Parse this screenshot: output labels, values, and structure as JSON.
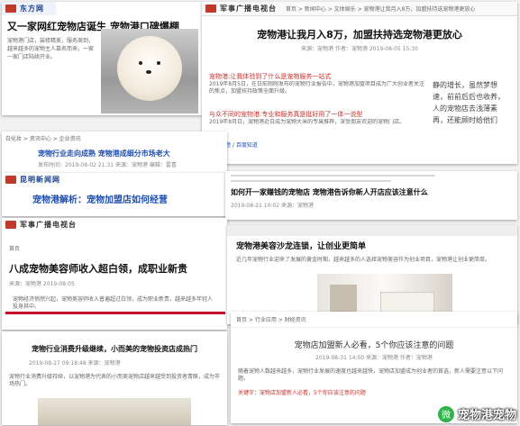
{
  "cards": {
    "c1": {
      "logo": "东方网",
      "headline": "又一家网红宠物店诞生 宠物港口碑爆棚",
      "body": "宠物港门店，装修精美，服务周到，越来越多的宠物主人慕名而来，一家一家门店陆续开业。"
    },
    "c2": {
      "breadcrumb": "首页 > 新闻中心 > 文体娱乐 > 宠物港让我月入8万，加盟扶持选宠物港更放心",
      "logo": "军事广播电视台",
      "headline": "宠物港让我月入8万，加盟扶持选宠物港更放心",
      "meta": "来源：宠物港 作者：宠物港 2019-08-05 15:30",
      "link1": "宠物港:让我体验到了什么是宠物服务一站式",
      "body1": "2019年8月5日，在日前刚刚发布的宠物行业报告中，宠物港加盟项目成为广大创业者关注的焦点，加盟扶持政策全面升级。",
      "link2": "与众不同的宠物港:专业和服务真是挺好用了一体一说型",
      "body2": "2019年8月日，宠物港近日成为宠物大米的专属推荐，深受朋友欢迎的宠物门店。",
      "aside": "静的增长，虽然梦想速，前前后后也收养，人的宠物店去浅薄素再，还能顾时给他们",
      "tag": "热点话题 / 百度知道"
    },
    "c3": {
      "breadcrumb": "白化妆 > 资讯中心 > 企业资讯",
      "headline": "宠物行业走向成熟 宠物港成细分市场老大",
      "meta": "发布时间：2019-08-02 21:31 来源：宠物港 编辑：雷喜"
    },
    "c4": {
      "logo": "昆明新闻网",
      "headline": "宠物港解析：宠物加盟店如何经营"
    },
    "c5": {
      "headline": "如何开一家赚钱的宠物店 宠物港告诉你新人开店应该注意什么",
      "meta": "2019-08-21 10:02 来源：宠物港"
    },
    "c6": {
      "logo": "军事广播电视台",
      "crumb": "首页",
      "headline": "八成宠物美容师收入超白领，成职业新贵",
      "meta": "来源：宠物港 2019-08-05",
      "body": "宠物经济悄然兴起，宠物美容师收入普遍超过白领，成为职业新贵，越来越多年轻人投身其中。"
    },
    "c7": {
      "headline": "宠物港美容沙龙连锁，让创业更简单",
      "body": "近几年宠物行业迎来了发展的黄金时期，越来越多的人选择宠物美容作为创业项目，宠物港让创业更简单。"
    },
    "c8": {
      "headline": "宠物行业消费升级继续，小而美的宠物投资店成热门",
      "meta": "2019-08-27 09:18:48 来源：宠物港",
      "body": "宠物行业消费升级持续，以宠物港为代表的小而美宠物店越来越受到投资者青睐，成为市场热门。"
    },
    "c9": {
      "crumb": "首页 > 行业应用 > 财经资讯",
      "headline": "宠物店加盟新人必看，5个你应该注意的问题",
      "meta": "2019-08-31 14:50 来源：宠物港 作者：宠物港",
      "body": "随着宠物人数越来越多，宠物行业发展的速度也越来越快，宠物店加盟成为创业者的首选，新人需要注意以下问题。",
      "keywords": "关键字：宠物店加盟新人必看，5个你应该注意的问题"
    }
  },
  "watermark": {
    "icon": "微",
    "text": "宠物港宠物"
  }
}
